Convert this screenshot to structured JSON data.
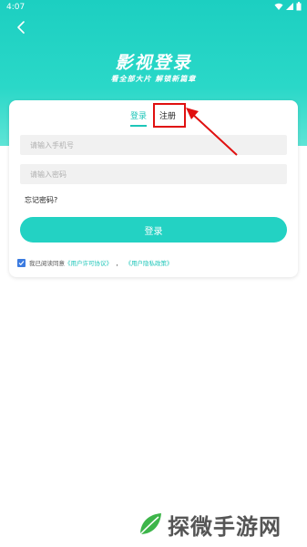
{
  "status_bar": {
    "time": "4:07"
  },
  "header": {
    "title": "影视登录",
    "subtitle": "看全部大片  解锁新篇章"
  },
  "tabs": {
    "login": "登录",
    "register": "注册"
  },
  "form": {
    "phone_placeholder": "请输入手机号",
    "password_placeholder": "请输入密码",
    "forgot_password": "忘记密码?",
    "login_button": "登录"
  },
  "agreement": {
    "prefix": "我已阅读同意",
    "user_agreement": "《用户许可协议》",
    "separator": "，",
    "privacy_policy": "《用户隐私政策》",
    "checked": true
  },
  "watermark": {
    "text": "探微手游网"
  },
  "colors": {
    "brand": "#23d2c3",
    "highlight": "#e01010",
    "checkbox": "#3b7be0"
  }
}
